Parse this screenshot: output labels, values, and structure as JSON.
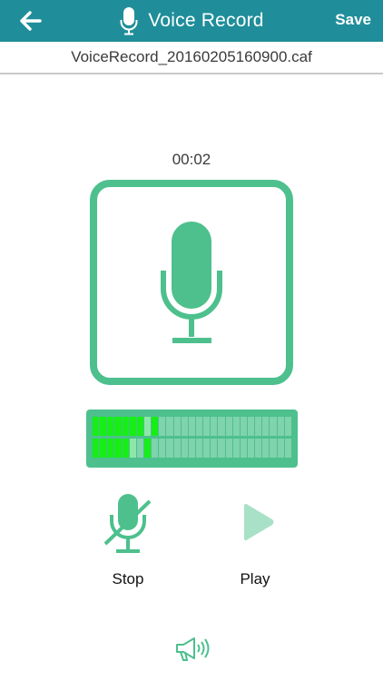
{
  "header": {
    "title": "Voice Record",
    "save_label": "Save",
    "back_icon": "arrow-left-icon",
    "title_icon": "microphone-icon",
    "background": "#1f8e9a"
  },
  "file": {
    "name": "VoiceRecord_20160205160900.caf"
  },
  "recorder": {
    "elapsed": "00:02",
    "accent_color": "#4dc08d",
    "level_meter": {
      "segments": 27,
      "channels": [
        {
          "level": 0.26,
          "peak": 0.33
        },
        {
          "level": 0.17,
          "peak": 0.3
        }
      ],
      "active_color": "#16ee16",
      "peak_color": "#16ee16",
      "inactive_color": "#7fd3ad"
    }
  },
  "controls": {
    "stop": {
      "label": "Stop",
      "icon": "microphone-off-icon"
    },
    "play": {
      "label": "Play",
      "icon": "play-icon"
    },
    "speaker_icon": "speaker-megaphone-icon"
  }
}
